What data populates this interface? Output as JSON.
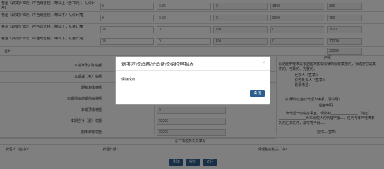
{
  "form": {
    "rows_top": [
      {
        "label": "卷烟（调拨价70元（不含增值税）/条以上（含70元））从价计算]",
        "c1": "0",
        "c2": "0.36",
        "c3": "0",
        "c4": "1800",
        "c5": "360"
      },
      {
        "label": "卷烟（调拨价70元（不含增值税）/条以下）从价计算]",
        "c1": "0",
        "c2": "0.36",
        "c3": "0",
        "c4": "2000",
        "c5": "720"
      },
      {
        "label": "卷烟（调拨价70元（不含增值税）/条以上，从量计算]",
        "c1": "30",
        "c2": "0",
        "c3": "300",
        "c4": "0",
        "c5": "3000"
      },
      {
        "label": "卷烟（调拨价70元（不含增值税）/条以下，从量计算]",
        "c1": "30",
        "c2": "0",
        "c3": "400",
        "c4": "0",
        "c5": "12000"
      }
    ],
    "total_label": "合计",
    "total_dashes": [
      "——",
      "——",
      "——",
      "——"
    ],
    "total_value": "22200",
    "declaration_header": "声明",
    "declaration_lines": [
      "此纳税申报表是根据国家税收法律的规定填报的，我确定它是真",
      "实的、可靠的、完整的。"
    ],
    "left_fields": [
      {
        "label": "本期准予扣除税额：",
        "value": ""
      },
      {
        "label": "本期减（免）税额：",
        "value": ""
      },
      {
        "label": "期初未缴税额：",
        "value": ""
      },
      {
        "label": "本期缴纳前期应纳税额：",
        "value": ""
      },
      {
        "label": "本期预缴税额：",
        "value": "0"
      },
      {
        "label": "本期应补（退）税额：",
        "value": "22200"
      },
      {
        "label": "期末未缴税额：",
        "value": "22200"
      }
    ],
    "right_fields": [
      "经办人（签章）：",
      "财务负责人（签章）：",
      "联系电话："
    ],
    "agent_note": "（如果你已委托代理人申报，请填写）",
    "auth_header": "授权声明",
    "auth_lines": [
      "为代理一切税务事宜，现授权______________（地址）",
      "______________为本纳税人的代理申报人，任何与本申报表有",
      "关的往来文件，都可寄予此人。"
    ],
    "auth_sign": "授权人签章：",
    "office_header": "以下由税务机关填写",
    "bottom_fields": [
      "受理人（签章）：",
      "受理日期：",
      "受理税务机关（章）："
    ],
    "buttons": [
      "重取",
      "提交",
      "返回"
    ]
  },
  "modal": {
    "title": "烟类应税消费品消费税纳税申报表",
    "close_symbol": "×",
    "message": "保存成功",
    "ok_label": "确 定"
  }
}
